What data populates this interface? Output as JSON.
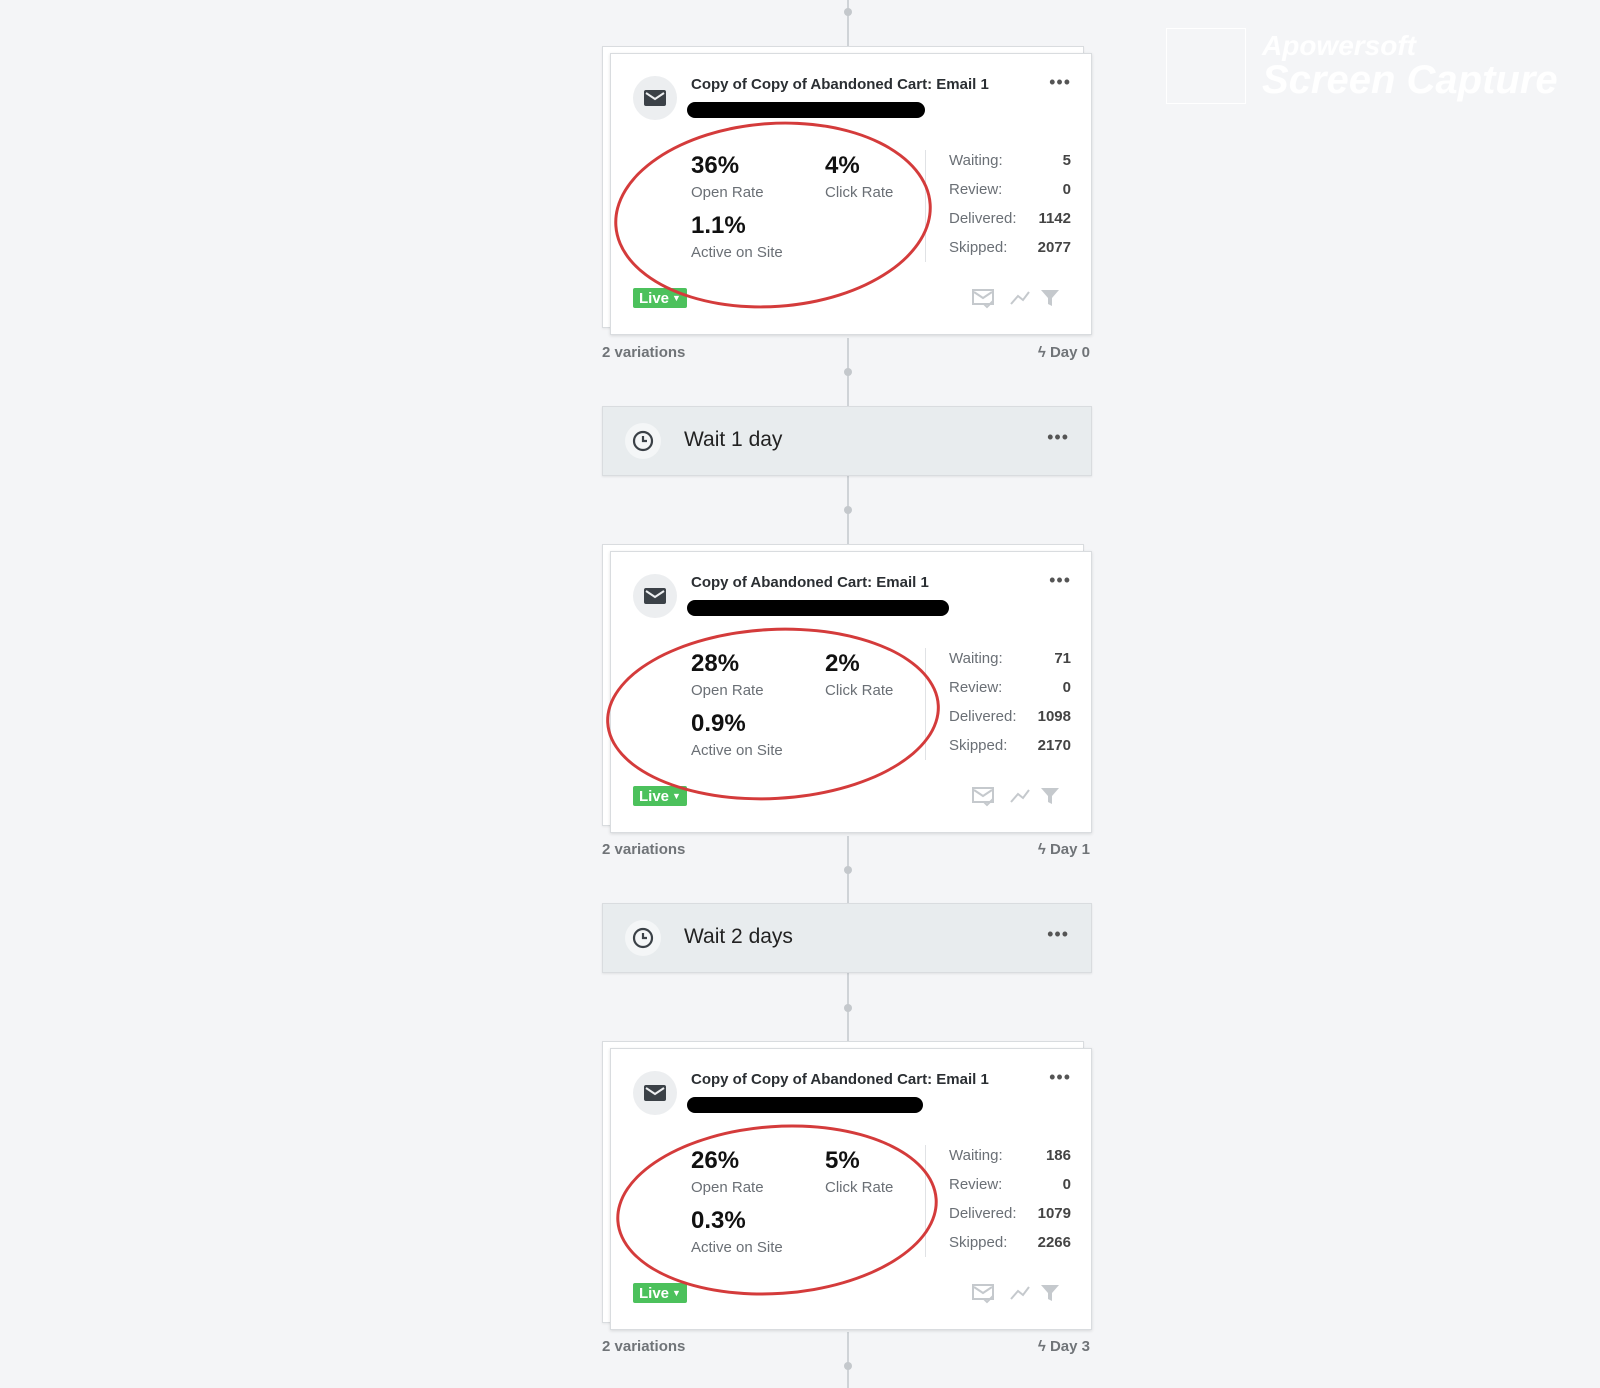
{
  "watermark": {
    "line1": "Apowersoft",
    "line2": "Screen Capture"
  },
  "emails": [
    {
      "title": "Copy of Copy of Abandoned Cart: Email 1",
      "open_rate": "36%",
      "open_label": "Open Rate",
      "click_rate": "4%",
      "click_label": "Click Rate",
      "active": "1.1%",
      "active_label": "Active on Site",
      "stats": [
        {
          "key": "Waiting:",
          "value": "5"
        },
        {
          "key": "Review:",
          "value": "0"
        },
        {
          "key": "Delivered:",
          "value": "1142"
        },
        {
          "key": "Skipped:",
          "value": "2077"
        }
      ],
      "status": "Live",
      "variations": "2 variations",
      "day": "Day 0"
    },
    {
      "title": "Copy of Abandoned Cart: Email 1",
      "open_rate": "28%",
      "open_label": "Open Rate",
      "click_rate": "2%",
      "click_label": "Click Rate",
      "active": "0.9%",
      "active_label": "Active on Site",
      "stats": [
        {
          "key": "Waiting:",
          "value": "71"
        },
        {
          "key": "Review:",
          "value": "0"
        },
        {
          "key": "Delivered:",
          "value": "1098"
        },
        {
          "key": "Skipped:",
          "value": "2170"
        }
      ],
      "status": "Live",
      "variations": "2 variations",
      "day": "Day 1"
    },
    {
      "title": "Copy of Copy of Abandoned Cart: Email 1",
      "open_rate": "26%",
      "open_label": "Open Rate",
      "click_rate": "5%",
      "click_label": "Click Rate",
      "active": "0.3%",
      "active_label": "Active on Site",
      "stats": [
        {
          "key": "Waiting:",
          "value": "186"
        },
        {
          "key": "Review:",
          "value": "0"
        },
        {
          "key": "Delivered:",
          "value": "1079"
        },
        {
          "key": "Skipped:",
          "value": "2266"
        }
      ],
      "status": "Live",
      "variations": "2 variations",
      "day": "Day 3"
    }
  ],
  "waits": [
    {
      "label": "Wait 1 day"
    },
    {
      "label": "Wait 2 days"
    }
  ],
  "icons": {
    "channel": "envelope-icon",
    "wait": "clock-icon",
    "more": "ellipsis-icon",
    "trigger": "lightning-icon",
    "actions": [
      "review-mail-icon",
      "trend-icon",
      "filter-icon"
    ]
  },
  "colors": {
    "live": "#4cc15c",
    "annotation": "#d43b3b",
    "background": "#f4f5f7"
  }
}
